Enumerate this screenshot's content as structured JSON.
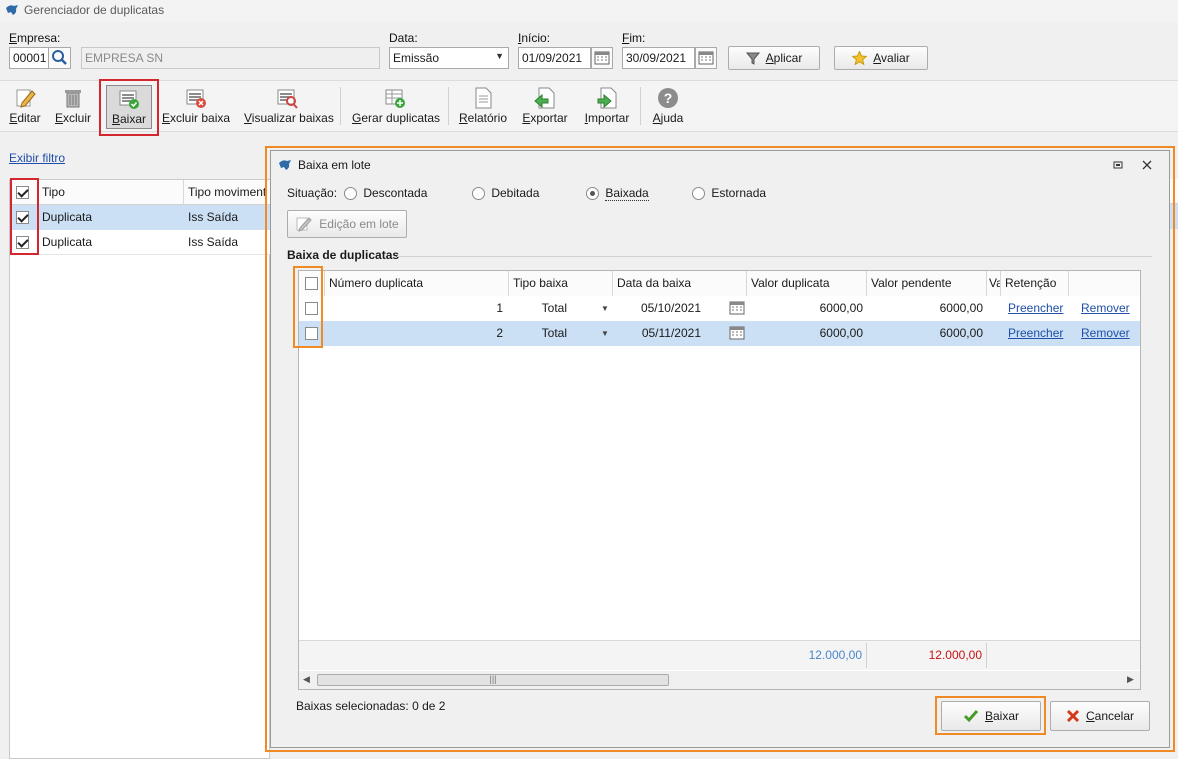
{
  "window": {
    "title": "Gerenciador de duplicatas"
  },
  "filters": {
    "empresa_label": "Empresa:",
    "empresa_code": "00001",
    "empresa_name": "EMPRESA SN",
    "data_label": "Data:",
    "data_value": "Emissão",
    "inicio_label": "Início:",
    "inicio_value": "01/09/2021",
    "fim_label": "Fim:",
    "fim_value": "30/09/2021",
    "aplicar_label": "Aplicar",
    "avaliar_label": "Avaliar"
  },
  "toolbar": {
    "editar": "Editar",
    "excluir": "Excluir",
    "baixar": "Baixar",
    "excluir_baixa": "Excluir baixa",
    "visualizar_baixas": "Visualizar baixas",
    "gerar_duplicatas": "Gerar duplicatas",
    "relatorio": "Relatório",
    "exportar": "Exportar",
    "importar": "Importar",
    "ajuda": "Ajuda"
  },
  "left": {
    "exibir_filtro": "Exibir filtro",
    "columns": [
      "Tipo",
      "Tipo moviment"
    ],
    "rows": [
      {
        "tipo": "Duplicata",
        "movimento": "Iss Saída"
      },
      {
        "tipo": "Duplicata",
        "movimento": "Iss Saída"
      }
    ]
  },
  "dialog": {
    "title": "Baixa em lote",
    "situacao_label": "Situação:",
    "options": [
      "Descontada",
      "Debitada",
      "Baixada",
      "Estornada"
    ],
    "selected_option": "Baixada",
    "edicao_label": "Edição em lote",
    "section_label": "Baixa de duplicatas",
    "columns": [
      "Número duplicata",
      "Tipo baixa",
      "Data da baixa",
      "Valor duplicata",
      "Valor pendente",
      "Va",
      "Retenção"
    ],
    "rows": [
      {
        "numero": "1",
        "tipo": "Total",
        "data": "05/10/2021",
        "valor": "6000,00",
        "pendente": "6000,00",
        "preencher": "Preencher",
        "remover": "Remover"
      },
      {
        "numero": "2",
        "tipo": "Total",
        "data": "05/11/2021",
        "valor": "6000,00",
        "pendente": "6000,00",
        "preencher": "Preencher",
        "remover": "Remover"
      }
    ],
    "totals": {
      "valor": "12.000,00",
      "pendente": "12.000,00"
    },
    "status": "Baixas selecionadas: 0 de 2",
    "baixar_label": "Baixar",
    "cancelar_label": "Cancelar"
  },
  "colors": {
    "accent_red": "#d3262f",
    "accent_orange": "#f08a24",
    "link": "#1f4fa8",
    "selected_row": "#cce0f5",
    "total_blue": "#4a86c8",
    "total_red": "#cc1111"
  }
}
